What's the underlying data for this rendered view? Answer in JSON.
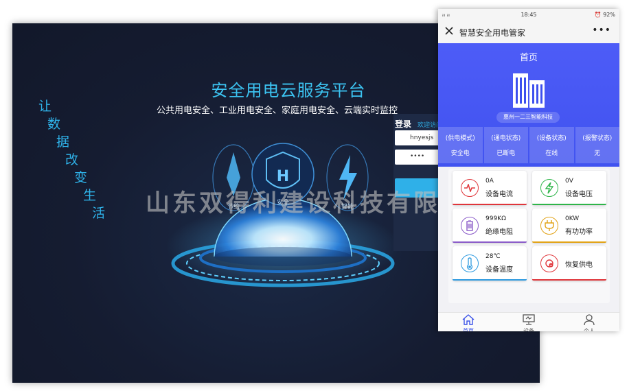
{
  "platform": {
    "slogan": [
      "让",
      "数",
      "据",
      "改",
      "变",
      "生",
      "活"
    ],
    "title": "安全用电云服务平台",
    "subtitle": "公共用电安全、工业用电安全、家庭用电安全、云端实时监控",
    "login": {
      "title": "登录",
      "welcome": "欢迎访问",
      "username": "hnyesjs",
      "password_mask": "••••"
    }
  },
  "watermark": "山东双得利建设科技有限",
  "phone": {
    "status_bar": {
      "signal": "ᵢₗₗ ᵢₗₗ",
      "time": "18:45",
      "battery": "92%"
    },
    "nav_title": "智慧安全用电管家",
    "nav_more": "•••",
    "page_title": "首页",
    "company": "惠州一二三智能科技",
    "status": [
      {
        "label": "(供电模式)",
        "value": "安全电"
      },
      {
        "label": "(通电状态)",
        "value": "已断电"
      },
      {
        "label": "(设备状态)",
        "value": "在线"
      },
      {
        "label": "(报警状态)",
        "value": "无"
      }
    ],
    "cards": [
      {
        "value": "0A",
        "label": "设备电流",
        "icon": "current-icon",
        "color": "#e0363b"
      },
      {
        "value": "0V",
        "label": "设备电压",
        "icon": "voltage-icon",
        "color": "#2fb54a"
      },
      {
        "value": "999KΩ",
        "label": "绝缘电阻",
        "icon": "resistance-icon",
        "color": "#8b5cc9"
      },
      {
        "value": "0KW",
        "label": "有功功率",
        "icon": "power-icon",
        "color": "#e2a317"
      },
      {
        "value": "28℃",
        "label": "设备温度",
        "icon": "thermometer-icon",
        "color": "#2f9be0"
      },
      {
        "value": "",
        "label": "恢复供电",
        "icon": "restore-power-icon",
        "color": "#e0363b"
      }
    ],
    "tabs": [
      {
        "label": "首页",
        "icon": "home-icon"
      },
      {
        "label": "设备",
        "icon": "device-icon"
      },
      {
        "label": "个人",
        "icon": "person-icon"
      }
    ],
    "accent": "#3d50ee"
  }
}
